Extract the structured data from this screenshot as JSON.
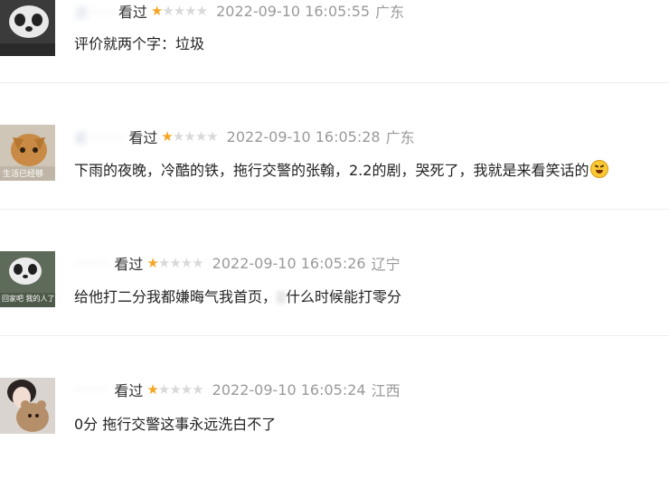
{
  "reviews": [
    {
      "username": "波·····",
      "status": "看过",
      "rating": 1,
      "time": "2022-09-10 16:05:55",
      "location": "广东",
      "content": "评价就两个字：垃圾"
    },
    {
      "username": "星·······",
      "status": "看过",
      "rating": 1,
      "time": "2022-09-10 16:05:28",
      "location": "广东",
      "content": "下雨的夜晚，冷酷的铁，拖行交警的张翰，2.2的剧，哭死了，我就是来看笑话的"
    },
    {
      "username": "·······",
      "status": "看过",
      "rating": 1,
      "time": "2022-09-10 16:05:26",
      "location": "辽宁",
      "content_a": "给他打二分我都嫌晦气我首页，",
      "content_b": "什么时候能打零分"
    },
    {
      "username": "·······",
      "status": "看过",
      "rating": 1,
      "time": "2022-09-10 16:05:24",
      "location": "江西",
      "content": "0分 拖行交警这事永远洗白不了"
    }
  ],
  "avatar_captions": {
    "r2": "生活已经够",
    "r3": "回家吧 我的人了"
  },
  "colors": {
    "star_on": "#f5a623",
    "star_off": "#d9d9d9",
    "meta_text": "#9a9a9a"
  }
}
